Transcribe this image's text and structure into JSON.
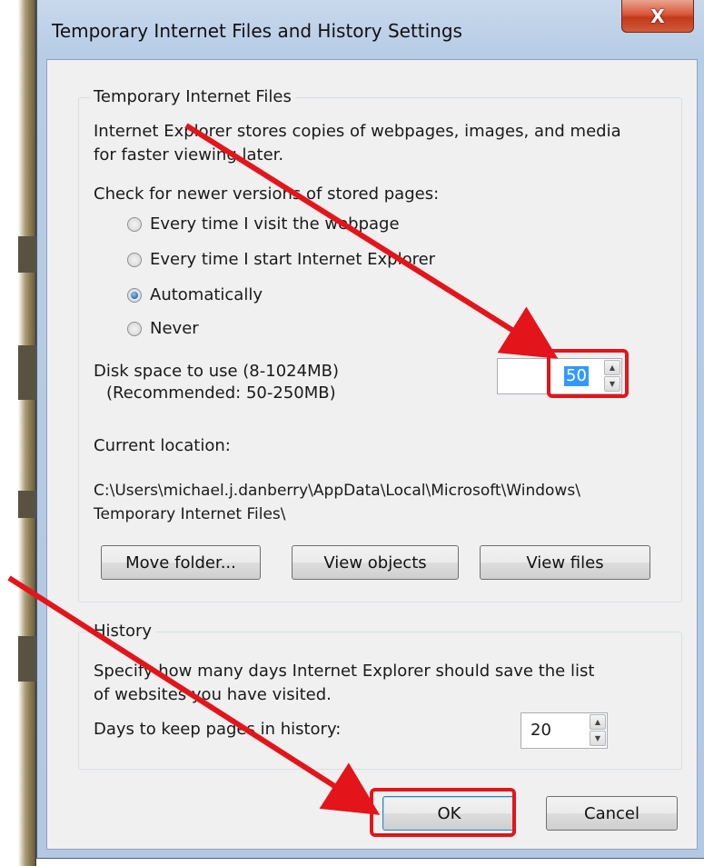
{
  "window": {
    "title": "Temporary Internet Files and History Settings",
    "close_label": "X"
  },
  "tif_group": {
    "legend": "Temporary Internet Files",
    "description_line1": "Internet Explorer stores copies of webpages, images, and media",
    "description_line2": "for faster viewing later.",
    "check_label": "Check for newer versions of stored pages:",
    "options": [
      {
        "label": "Every time I visit the webpage",
        "checked": false
      },
      {
        "label": "Every time I start Internet Explorer",
        "checked": false
      },
      {
        "label": "Automatically",
        "checked": true
      },
      {
        "label": "Never",
        "checked": false
      }
    ],
    "disk_label": "Disk space to use (8-1024MB)",
    "disk_recommended": "(Recommended: 50-250MB)",
    "disk_value": "50",
    "location_label": "Current location:",
    "location_line1": "C:\\Users\\michael.j.danberry\\AppData\\Local\\Microsoft\\Windows\\",
    "location_line2": "Temporary Internet Files\\",
    "buttons": {
      "move_folder": "Move folder...",
      "view_objects": "View objects",
      "view_files": "View files"
    }
  },
  "history_group": {
    "legend": "History",
    "description_line1": "Specify how many days Internet Explorer should save the list",
    "description_line2": "of websites you have visited.",
    "days_label": "Days to keep pages in history:",
    "days_value": "20"
  },
  "footer": {
    "ok_label": "OK",
    "cancel_label": "Cancel"
  },
  "annotation_color": "#e3151a"
}
